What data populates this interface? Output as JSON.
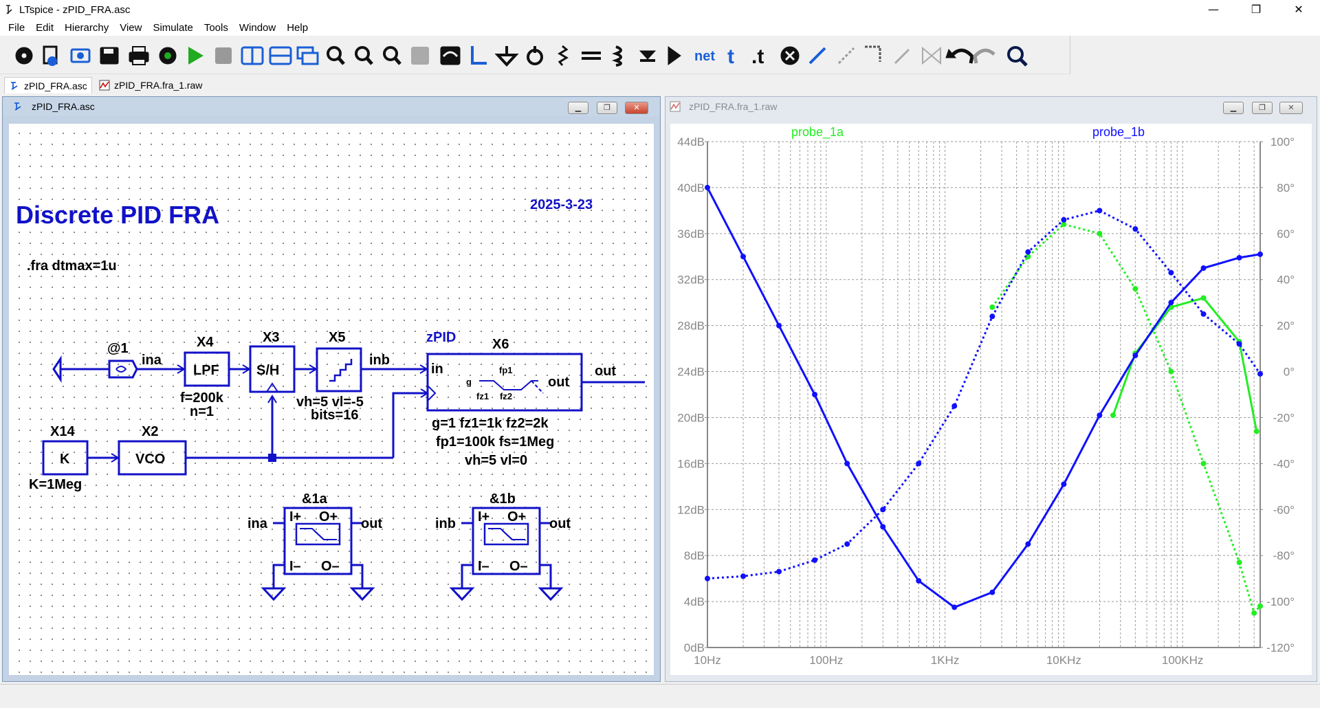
{
  "window": {
    "title": "LTspice - zPID_FRA.asc",
    "controls": {
      "minimize": "—",
      "maximize": "❐",
      "close": "✕"
    }
  },
  "menu": [
    "File",
    "Edit",
    "Hierarchy",
    "View",
    "Simulate",
    "Tools",
    "Window",
    "Help"
  ],
  "toolbar": {
    "items": [
      "settings-gear-icon",
      "new-schematic-icon",
      "open-icon",
      "save-icon",
      "print-icon",
      "control-panel-icon",
      "run-icon",
      "stop-icon",
      "tile-vertical-icon",
      "tile-horizontal-icon",
      "cascade-icon",
      "zoom-in-icon",
      "zoom-out-icon",
      "zoom-fit-icon",
      "zoom-back-icon",
      "autorange-icon",
      "wire-icon",
      "ground-icon",
      "label-net-icon",
      "resistor-icon",
      "capacitor-icon",
      "inductor-icon",
      "diode-icon",
      "component-icon",
      "net-label-icon",
      "text-icon",
      "spice-directive-icon",
      "delete-icon",
      "move-icon",
      "drag-icon",
      "rotate-icon",
      "mirror-icon",
      "flip-icon",
      "undo-icon",
      "redo-icon",
      "find-icon"
    ],
    "net_label": "net",
    "text_label": "t",
    "directive_label": ".t"
  },
  "tabs": [
    {
      "label": "zPID_FRA.asc",
      "active": true,
      "icon": "schematic-icon"
    },
    {
      "label": "zPID_FRA.fra_1.raw",
      "active": false,
      "icon": "waveform-icon"
    }
  ],
  "schematic_window": {
    "title": "zPID_FRA.asc",
    "heading": "Discrete PID FRA",
    "date": "2025-3-23",
    "directive": ".fra dtmax=1u",
    "components": {
      "src_ref": "@1",
      "lpf_ref": "X4",
      "lpf_label": "LPF",
      "lpf_param1": "f=200k",
      "lpf_param2": "n=1",
      "sh_ref": "X3",
      "sh_label": "S/H",
      "q_ref": "X5",
      "q_param1": "vh=5 vl=-5",
      "q_param2": "bits=16",
      "pid_name": "zPID",
      "pid_ref": "X6",
      "pid_in": "in",
      "pid_out": "out",
      "pid_g": "g",
      "pid_fz1": "fz1",
      "pid_fz2": "fz2",
      "pid_fp1": "fp1",
      "pid_param1": "g=1 fz1=1k fz2=2k",
      "pid_param2": "fp1=100k  fs=1Meg",
      "pid_param3": "vh=5 vl=0",
      "k_ref": "X14",
      "k_label": "K",
      "k_param": "K=1Meg",
      "vco_ref": "X2",
      "vco_label": "VCO",
      "probe_a_ref": "&1a",
      "probe_b_ref": "&1b",
      "probe_ip": "I+",
      "probe_op": "O+",
      "probe_im": "I–",
      "probe_om": "O–"
    },
    "nets": {
      "ina": "ina",
      "inb": "inb",
      "out": "out",
      "probe_a_in": "ina",
      "probe_a_out": "out",
      "probe_b_in": "inb",
      "probe_b_out": "out"
    }
  },
  "plot_window": {
    "title": "zPID_FRA.fra_1.raw",
    "legend": [
      "probe_1a",
      "probe_1b"
    ]
  },
  "chart_data": {
    "type": "line",
    "xscale": "log",
    "x_ticks": [
      "10Hz",
      "100Hz",
      "1KHz",
      "10KHz",
      "100KHz"
    ],
    "xlim_hz": [
      10,
      450000
    ],
    "y_left_ticks": [
      "44dB",
      "40dB",
      "36dB",
      "32dB",
      "28dB",
      "24dB",
      "20dB",
      "16dB",
      "12dB",
      "8dB",
      "4dB",
      "0dB"
    ],
    "y_right_ticks": [
      "100°",
      "80°",
      "60°",
      "40°",
      "20°",
      "0°",
      "-20°",
      "-40°",
      "-60°",
      "-80°",
      "-100°",
      "-120°"
    ],
    "ylim_left": [
      0,
      44
    ],
    "ylim_right": [
      -120,
      100
    ],
    "grid": true,
    "series": [
      {
        "name": "probe_1a",
        "color": "#22ee22",
        "style": "solid",
        "axis": "left",
        "x": [
          26000,
          40000,
          80000,
          150000,
          300000,
          420000
        ],
        "y": [
          20.2,
          25.6,
          29.6,
          30.4,
          26.6,
          18.8
        ]
      },
      {
        "name": "probe_1a",
        "color": "#22ee22",
        "style": "dotted",
        "axis": "right",
        "x": [
          2500,
          5000,
          10000,
          20000,
          40000,
          80000,
          150000,
          300000,
          400000,
          450000
        ],
        "y": [
          28,
          50,
          64,
          60,
          36,
          0,
          -40,
          -83,
          -105,
          -102
        ]
      },
      {
        "name": "probe_1b",
        "color": "#1010ff",
        "style": "solid",
        "axis": "left",
        "x": [
          10,
          20,
          40,
          80,
          150,
          300,
          600,
          1200,
          2500,
          5000,
          10000,
          20000,
          40000,
          80000,
          150000,
          300000,
          450000
        ],
        "y": [
          40,
          34,
          28,
          22,
          16,
          10.5,
          5.8,
          3.5,
          4.8,
          9,
          14.2,
          20.2,
          25.4,
          30,
          33,
          33.9,
          34.2
        ]
      },
      {
        "name": "probe_1b",
        "color": "#1010ff",
        "style": "dotted",
        "axis": "right",
        "x": [
          10,
          20,
          40,
          80,
          150,
          300,
          600,
          1200,
          2500,
          5000,
          10000,
          20000,
          40000,
          80000,
          150000,
          300000,
          450000
        ],
        "y": [
          -90,
          -89,
          -87,
          -82,
          -75,
          -60,
          -40,
          -15,
          24,
          52,
          66,
          70,
          62,
          43,
          25,
          12,
          -1
        ]
      }
    ]
  }
}
